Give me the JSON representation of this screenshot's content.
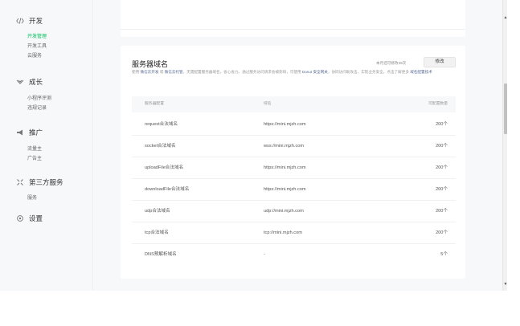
{
  "sidebar": {
    "groups": [
      {
        "icon": "code-icon",
        "label": "开发",
        "items": [
          {
            "label": "开发管理",
            "active": true
          },
          {
            "label": "开发工具",
            "active": false
          },
          {
            "label": "云服务",
            "active": false
          }
        ]
      },
      {
        "icon": "growth-icon",
        "label": "成长",
        "items": [
          {
            "label": "小程序评测",
            "active": false
          },
          {
            "label": "违规记录",
            "active": false
          }
        ]
      },
      {
        "icon": "megaphone-icon",
        "label": "推广",
        "items": [
          {
            "label": "流量主",
            "active": false
          },
          {
            "label": "广告主",
            "active": false
          }
        ]
      },
      {
        "icon": "puzzle-icon",
        "label": "第三方服务",
        "items": [
          {
            "label": "服务",
            "active": false
          }
        ]
      },
      {
        "icon": "settings-icon",
        "label": "设置",
        "items": []
      }
    ]
  },
  "server_domain": {
    "title": "服务器域名",
    "quota_text": "本月还可修改49次",
    "modify_label": "修改",
    "desc_prefix": "使用",
    "desc_link1": "微信云开发",
    "desc_mid1": "或",
    "desc_link2": "微信云托管",
    "desc_mid2": "，无需配置服务器域名，省心省力。通过服务访问请求会被影响，可使用",
    "desc_link3": "Donut 安全网关",
    "desc_mid3": "，协同访问助攻击，实现业务安全。点击了解更多",
    "desc_link4": "域名配置技术",
    "columns": [
      "服务器配置",
      "域名",
      "可配置数量"
    ],
    "rows": [
      {
        "name": "request合法域名",
        "domain": "https://mini.mjzh.com",
        "count": "200个"
      },
      {
        "name": "socket合法域名",
        "domain": "wss://mini.mjzh.com",
        "count": "200个"
      },
      {
        "name": "uploadFile合法域名",
        "domain": "https://mini.mjzh.com",
        "count": "200个"
      },
      {
        "name": "downloadFile合法域名",
        "domain": "https://mini.mjzh.com",
        "count": "200个"
      },
      {
        "name": "udp合法域名",
        "domain": "udp://mini.mjzh.com",
        "count": "200个"
      },
      {
        "name": "tcp合法域名",
        "domain": "tcp://mini.mjzh.com",
        "count": "200个"
      },
      {
        "name": "DNS预解析域名",
        "domain": "-",
        "count": "5个"
      }
    ]
  },
  "scrollbar": {
    "up": "▲",
    "down": "▼"
  }
}
